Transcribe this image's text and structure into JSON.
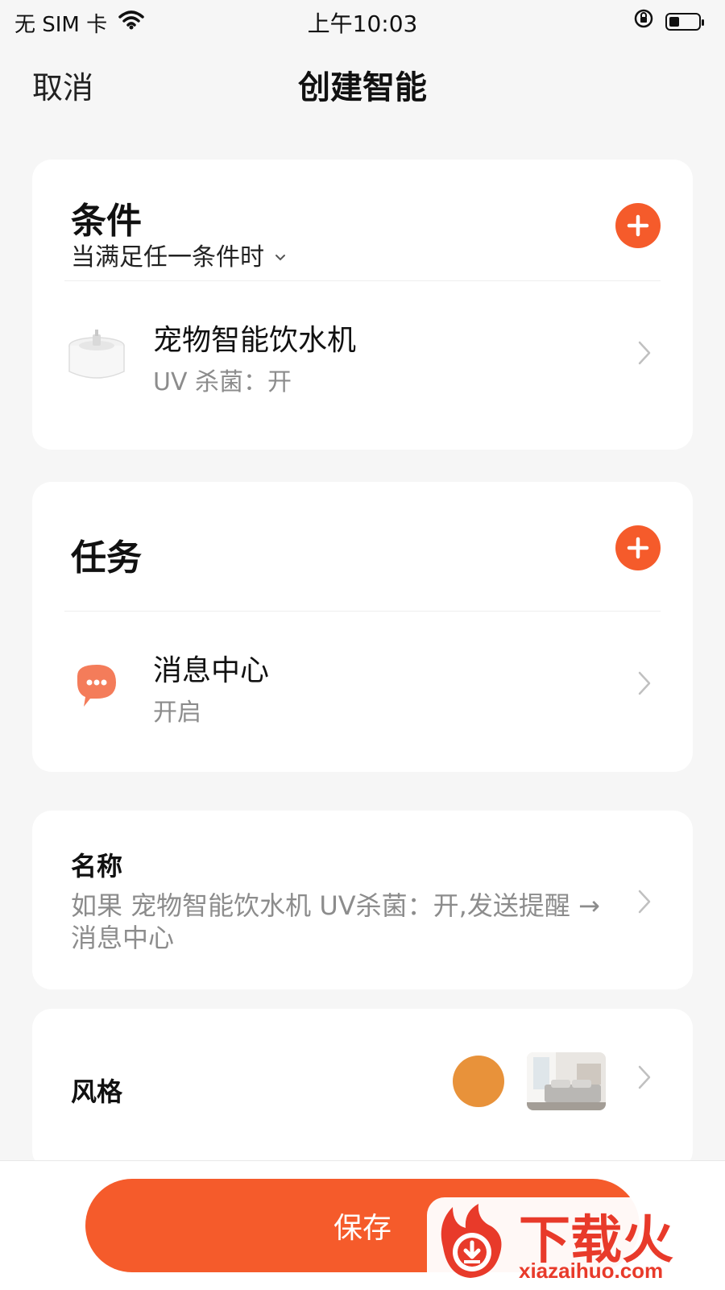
{
  "status_bar": {
    "carrier": "无 SIM 卡",
    "time": "上午10:03"
  },
  "nav": {
    "cancel_label": "取消",
    "title": "创建智能"
  },
  "conditions": {
    "title": "条件",
    "mode": "当满足任一条件时",
    "items": [
      {
        "title": "宠物智能饮水机",
        "subtitle": "UV 杀菌：开",
        "icon": "pet-fountain-image"
      }
    ]
  },
  "tasks": {
    "title": "任务",
    "items": [
      {
        "title": "消息中心",
        "subtitle": "开启",
        "icon": "message-bubble-icon"
      }
    ]
  },
  "name": {
    "label": "名称",
    "value": "如果 宠物智能饮水机 UV杀菌：开,发送提醒 → 消息中心"
  },
  "style": {
    "label": "风格",
    "color": "#e8923a",
    "thumbnail": "bedroom-image"
  },
  "save_label": "保存",
  "watermark": {
    "brand": "下载火",
    "url": "xiazaihuo.com"
  },
  "colors": {
    "accent": "#f55b2b",
    "watermark_red": "#e83a2a"
  }
}
